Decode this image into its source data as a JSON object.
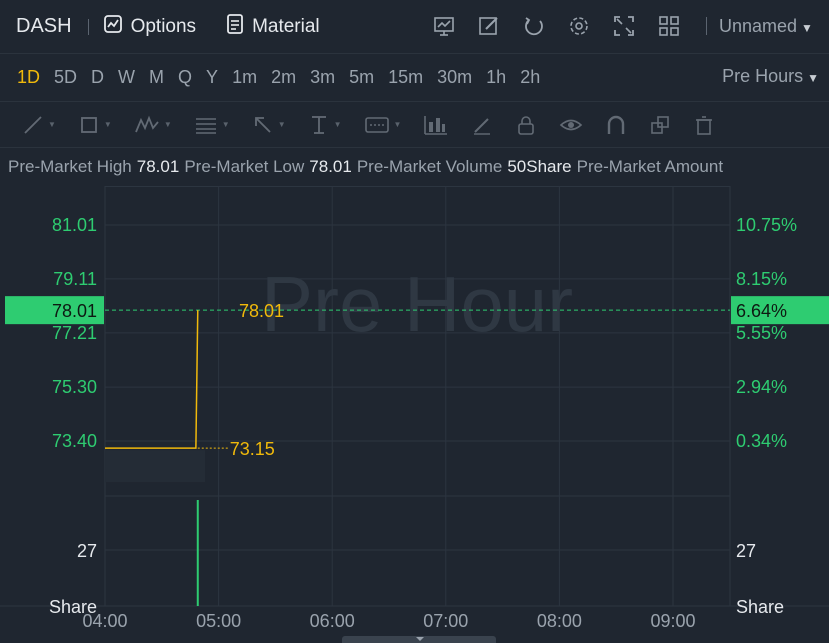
{
  "topbar": {
    "ticker": "DASH",
    "options_label": "Options",
    "material_label": "Material",
    "icons": [
      "chart-template-icon",
      "draw-edit-icon",
      "refresh-icon",
      "settings-icon",
      "fullscreen-icon",
      "layout-grid-icon"
    ],
    "layout_name": "Unnamed"
  },
  "periods": {
    "items": [
      "1D",
      "5D",
      "D",
      "W",
      "M",
      "Q",
      "Y",
      "1m",
      "2m",
      "3m",
      "5m",
      "15m",
      "30m",
      "1h",
      "2h"
    ],
    "active": "1D",
    "session": "Pre Hours"
  },
  "info": {
    "high_label": "Pre-Market High",
    "high_value": "78.01",
    "low_label": "Pre-Market Low",
    "low_value": "78.01",
    "volume_label": "Pre-Market Volume",
    "volume_value": "50Share",
    "amount_label": "Pre-Market Amount"
  },
  "chart_data": {
    "type": "line",
    "watermark": "Pre Hour",
    "price_axis_left": [
      "81.01",
      "79.11",
      "77.21",
      "75.30",
      "73.40"
    ],
    "price_axis_right": [
      "10.75%",
      "8.15%",
      "5.55%",
      "2.94%",
      "0.34%"
    ],
    "price_ticks": [
      81.01,
      79.11,
      77.21,
      75.3,
      73.4
    ],
    "current_price": "78.01",
    "current_pct": "6.64%",
    "prev_close": "73.15",
    "last_price_label": "78.01",
    "series": [
      {
        "values": [
          [
            0,
            73.15
          ],
          [
            48,
            73.15
          ],
          [
            49,
            78.01
          ]
        ]
      }
    ],
    "volume_axis_left": [
      "27"
    ],
    "volume_axis_right": [
      "27"
    ],
    "volume_unit": "Share",
    "volume_bars": [
      {
        "x": 49,
        "v": 50
      }
    ],
    "volume_max": 50,
    "x_ticks": [
      "04:00",
      "05:00",
      "06:00",
      "07:00",
      "08:00",
      "09:00"
    ],
    "x_range_minutes": [
      0,
      330
    ],
    "colors": {
      "line": "#f0b90b",
      "up": "#2ecc71",
      "price_label_bg": "#2ecc71",
      "grid": "#2c3540"
    }
  }
}
